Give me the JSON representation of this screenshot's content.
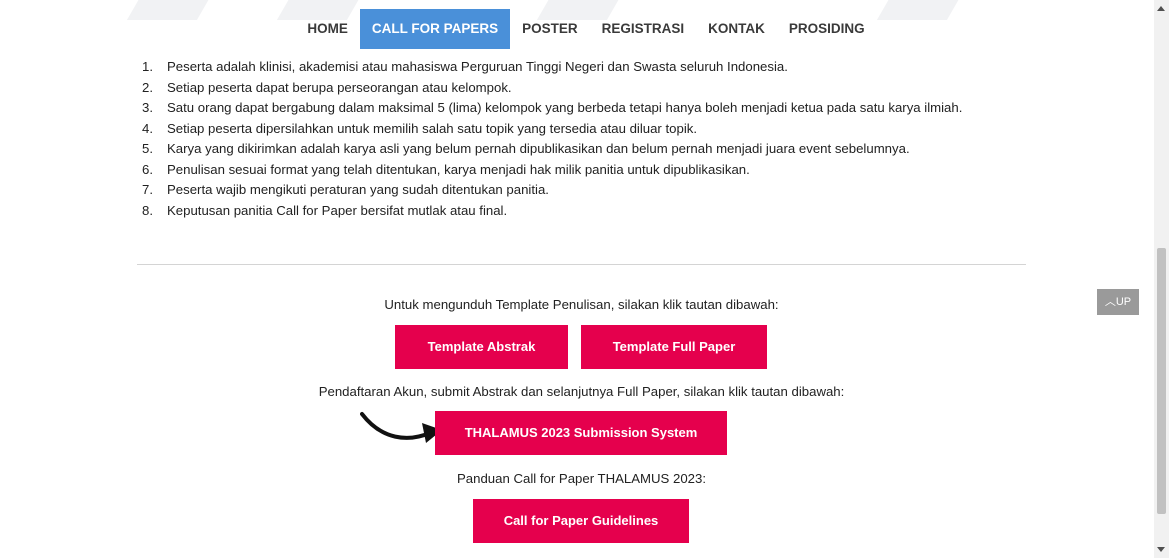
{
  "nav": {
    "items": [
      {
        "label": "HOME",
        "active": false
      },
      {
        "label": "CALL FOR PAPERS",
        "active": true
      },
      {
        "label": "POSTER",
        "active": false
      },
      {
        "label": "REGISTRASI",
        "active": false
      },
      {
        "label": "KONTAK",
        "active": false
      },
      {
        "label": "PROSIDING",
        "active": false
      }
    ]
  },
  "rules": [
    {
      "num": "1.",
      "text": "Peserta adalah klinisi, akademisi atau mahasiswa Perguruan Tinggi Negeri dan Swasta seluruh Indonesia."
    },
    {
      "num": "2.",
      "text": "Setiap peserta dapat berupa perseorangan atau kelompok."
    },
    {
      "num": "3.",
      "text": "Satu orang dapat bergabung dalam maksimal 5 (lima) kelompok yang berbeda tetapi hanya boleh menjadi ketua pada satu karya ilmiah."
    },
    {
      "num": "4.",
      "text": "Setiap peserta dipersilahkan untuk memilih salah satu topik yang tersedia atau diluar topik."
    },
    {
      "num": "5.",
      "text": "Karya yang dikirimkan adalah karya asli yang belum pernah dipublikasikan dan belum pernah menjadi juara event sebelumnya."
    },
    {
      "num": "6.",
      "text": "Penulisan sesuai format yang telah ditentukan, karya menjadi hak milik panitia untuk dipublikasikan."
    },
    {
      "num": "7.",
      "text": "Peserta wajib mengikuti peraturan yang sudah ditentukan panitia."
    },
    {
      "num": "8.",
      "text": "Keputusan panitia Call for Paper bersifat mutlak atau final."
    }
  ],
  "template_section": {
    "text": "Untuk mengunduh Template Penulisan, silakan klik tautan dibawah:",
    "abstract_button": "Template Abstrak",
    "fullpaper_button": "Template Full Paper"
  },
  "submission_section": {
    "text": "Pendaftaran Akun, submit Abstrak dan selanjutnya Full Paper, silakan klik tautan dibawah:",
    "button": "THALAMUS 2023 Submission System"
  },
  "guideline_section": {
    "text": "Panduan Call for Paper THALAMUS 2023:",
    "button": "Call for Paper Guidelines"
  },
  "up_button": {
    "label": "UP",
    "icon": "chevron-up-icon"
  },
  "colors": {
    "accent": "#e5004d",
    "nav_active": "#4a90d9"
  }
}
